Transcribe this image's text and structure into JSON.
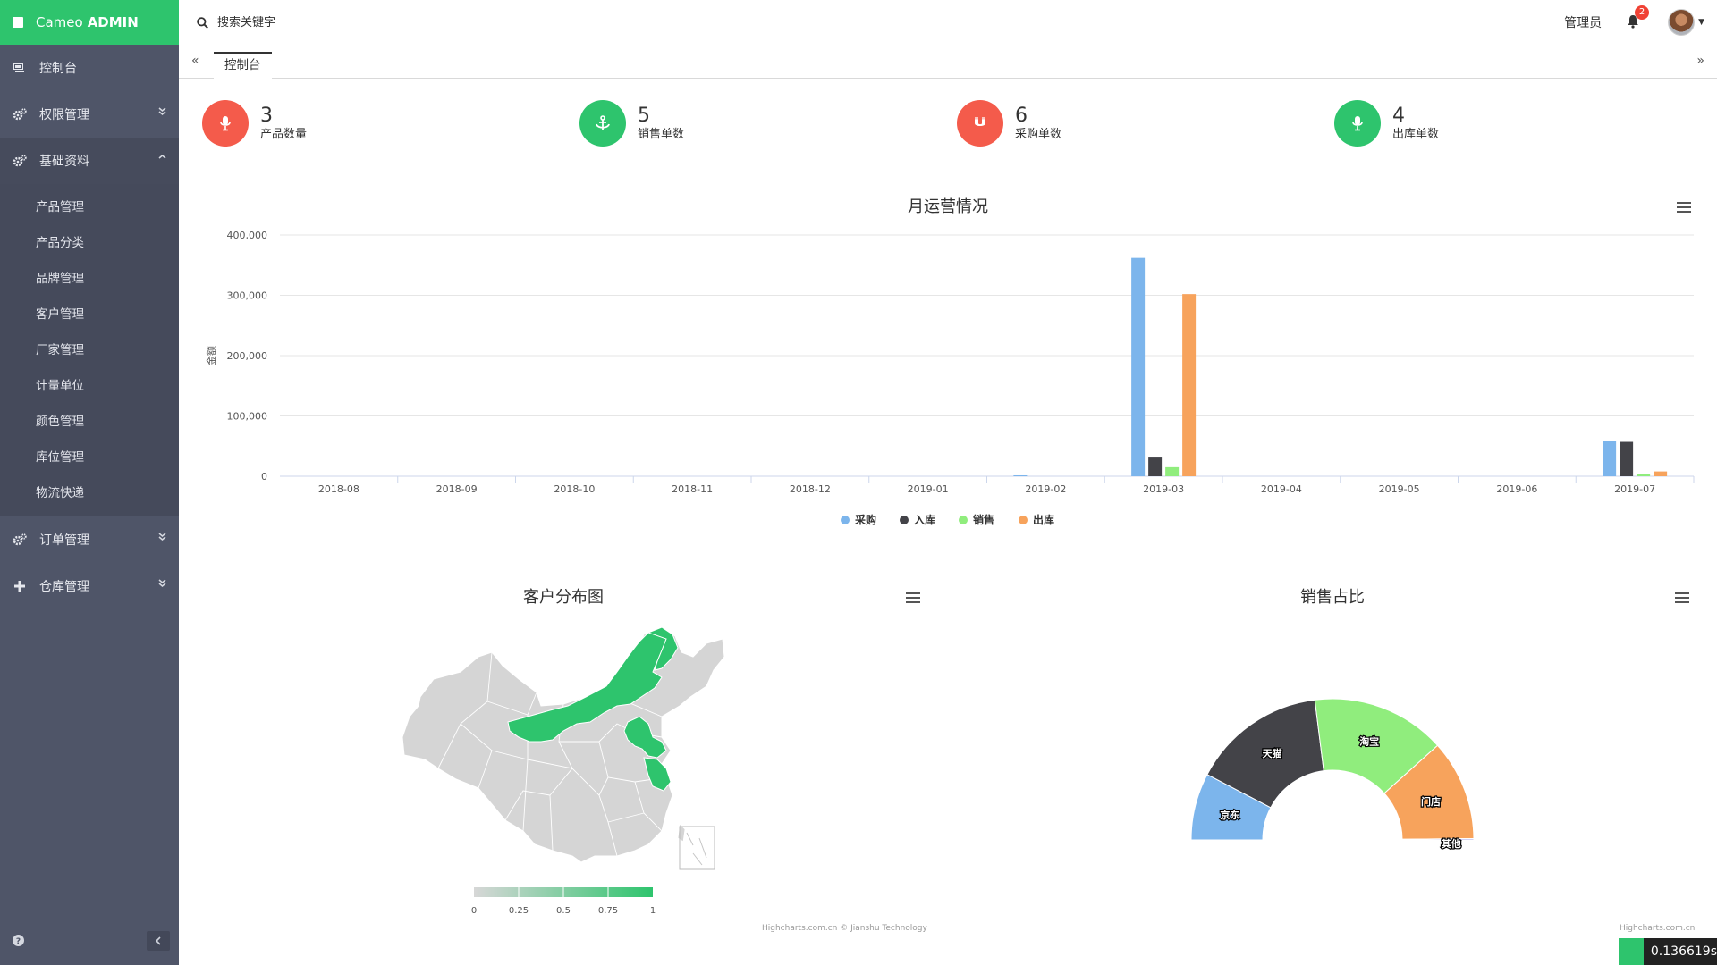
{
  "app": {
    "brand_prefix": "Cameo",
    "brand_bold": "ADMIN"
  },
  "sidebar": {
    "items": [
      {
        "label": "控制台",
        "icon": "dashboard-icon"
      },
      {
        "label": "权限管理",
        "icon": "cogs-icon",
        "expandable": true,
        "expanded": false
      },
      {
        "label": "基础资料",
        "icon": "cogs-icon",
        "expandable": true,
        "expanded": true
      },
      {
        "label": "订单管理",
        "icon": "cogs-icon",
        "expandable": true,
        "expanded": false
      },
      {
        "label": "仓库管理",
        "icon": "plus-icon",
        "expandable": true,
        "expanded": false
      }
    ],
    "submenu": [
      "产品管理",
      "产品分类",
      "品牌管理",
      "客户管理",
      "厂家管理",
      "计量单位",
      "颜色管理",
      "库位管理",
      "物流快递"
    ]
  },
  "header": {
    "search_placeholder": "搜索关键字",
    "user_label": "管理员",
    "notification_count": "2"
  },
  "tabs": {
    "active": "控制台"
  },
  "stats": [
    {
      "value": "3",
      "label": "产品数量",
      "color": "#f45b4b",
      "icon": "microphone-icon"
    },
    {
      "value": "5",
      "label": "销售单数",
      "color": "#2ec46d",
      "icon": "anchor-icon"
    },
    {
      "value": "6",
      "label": "采购单数",
      "color": "#f45b4b",
      "icon": "magnet-icon"
    },
    {
      "value": "4",
      "label": "出库单数",
      "color": "#2ec46d",
      "icon": "microphone-icon"
    }
  ],
  "chart_data": [
    {
      "type": "bar",
      "title": "月运营情况",
      "ylabel": "金额",
      "xlabel": "",
      "ylim": [
        0,
        400000
      ],
      "yticks": [
        "0",
        "100,000",
        "200,000",
        "300,000",
        "400,000"
      ],
      "categories": [
        "2018-08",
        "2018-09",
        "2018-10",
        "2018-11",
        "2018-12",
        "2019-01",
        "2019-02",
        "2019-03",
        "2019-04",
        "2019-05",
        "2019-06",
        "2019-07"
      ],
      "series": [
        {
          "name": "采购",
          "color": "#7cb5ec",
          "values": [
            0,
            0,
            0,
            0,
            0,
            0,
            1500,
            362000,
            0,
            0,
            0,
            58000
          ]
        },
        {
          "name": "入库",
          "color": "#434348",
          "values": [
            0,
            0,
            0,
            0,
            0,
            0,
            0,
            31000,
            0,
            0,
            0,
            57000
          ]
        },
        {
          "name": "销售",
          "color": "#90ed7d",
          "values": [
            0,
            0,
            0,
            0,
            0,
            0,
            0,
            15000,
            0,
            0,
            0,
            3000
          ]
        },
        {
          "name": "出库",
          "color": "#f7a35c",
          "values": [
            0,
            0,
            0,
            0,
            0,
            0,
            0,
            302000,
            0,
            0,
            0,
            8000
          ]
        }
      ],
      "legend": "bottom-center",
      "grid": true
    },
    {
      "type": "map",
      "title": "客户分布图",
      "colorAxis": {
        "min": 0,
        "max": 1,
        "ticks": [
          "0",
          "0.25",
          "0.5",
          "0.75",
          "1"
        ],
        "minColor": "#d7d7d7",
        "maxColor": "#2ec46d"
      },
      "credit": "Highcharts.com.cn © Jianshu Technology"
    },
    {
      "type": "pie",
      "title": "销售占比",
      "semicircle": true,
      "slices": [
        {
          "name": "京东",
          "value": 1,
          "color": "#7cb5ec"
        },
        {
          "name": "天猫",
          "value": 2,
          "color": "#434348"
        },
        {
          "name": "淘宝",
          "value": 2,
          "color": "#90ed7d"
        },
        {
          "name": "门店",
          "value": 1.5,
          "color": "#f7a35c"
        },
        {
          "name": "其他",
          "value": 0.02,
          "color": "#8085e9"
        }
      ],
      "credit": "Highcharts.com.cn"
    }
  ],
  "timer": "0.136619s"
}
